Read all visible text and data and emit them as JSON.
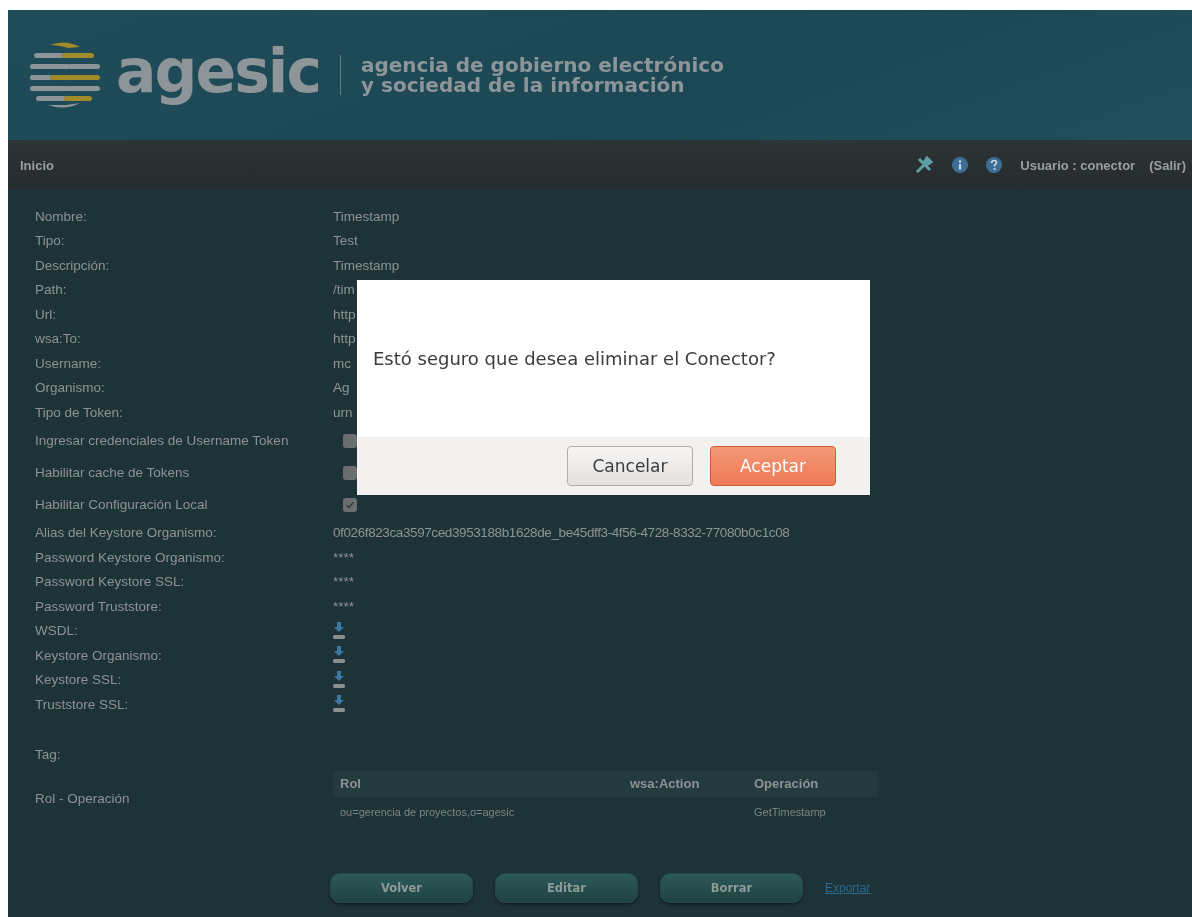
{
  "header": {
    "logo": "agesic",
    "tagline": [
      "agencia de gobierno electrónico",
      "y sociedad de la información"
    ]
  },
  "navbar": {
    "home": "Inicio",
    "user": "Usuario : conector",
    "logout": "(Salir)"
  },
  "fields": [
    {
      "kind": "text",
      "label": "Nombre:",
      "value": "Timestamp"
    },
    {
      "kind": "text",
      "label": "Tipo:",
      "value": "Test"
    },
    {
      "kind": "text",
      "label": "Descripción:",
      "value": "Timestamp"
    },
    {
      "kind": "text",
      "label": "Path:",
      "value": "/tim"
    },
    {
      "kind": "text",
      "label": "Url:",
      "value": "http"
    },
    {
      "kind": "text",
      "label": "wsa:To:",
      "value": "http"
    },
    {
      "kind": "text",
      "label": "Username:",
      "value": "mc"
    },
    {
      "kind": "text",
      "label": "Organismo:",
      "value": "Ag"
    },
    {
      "kind": "text",
      "label": "Tipo de Token:",
      "value": "urn"
    },
    {
      "kind": "checkbox",
      "label": "Ingresar credenciales de Username Token",
      "checked": false
    },
    {
      "kind": "checkbox",
      "label": "Habilitar cache de Tokens",
      "checked": false
    },
    {
      "kind": "checkbox",
      "label": "Habilitar Configuración Local",
      "checked": true
    },
    {
      "kind": "text",
      "label": "Alias del Keystore Organismo:",
      "value": "0f026f823ca3597ced3953188b1628de_be45dff3-4f56-4728-8332-77080b0c1c08"
    },
    {
      "kind": "secret",
      "label": "Password Keystore Organismo:",
      "value": "****"
    },
    {
      "kind": "secret",
      "label": "Password Keystore SSL:",
      "value": "****"
    },
    {
      "kind": "secret",
      "label": "Password Truststore:",
      "value": "****"
    },
    {
      "kind": "download",
      "label": "WSDL:"
    },
    {
      "kind": "download",
      "label": "Keystore Organismo:"
    },
    {
      "kind": "download",
      "label": "Keystore SSL:"
    },
    {
      "kind": "download",
      "label": "Truststore SSL:"
    }
  ],
  "tag_label": "Tag:",
  "roles": {
    "label": "Rol - Operación",
    "columns": [
      "Rol",
      "wsa:Action",
      "Operación"
    ],
    "rows": [
      [
        "ou=gerencia de proyectos,o=agesic",
        "",
        "GetTimestamp"
      ]
    ]
  },
  "buttons": [
    "Volver",
    "Editar",
    "Borrar"
  ],
  "export_link": "Exportar",
  "dialog": {
    "message": "Estó seguro que desea eliminar el Conector?",
    "buttons": [
      {
        "label": "Cancelar",
        "kind": "secondary"
      },
      {
        "label": "Aceptar",
        "kind": "primary"
      }
    ]
  }
}
